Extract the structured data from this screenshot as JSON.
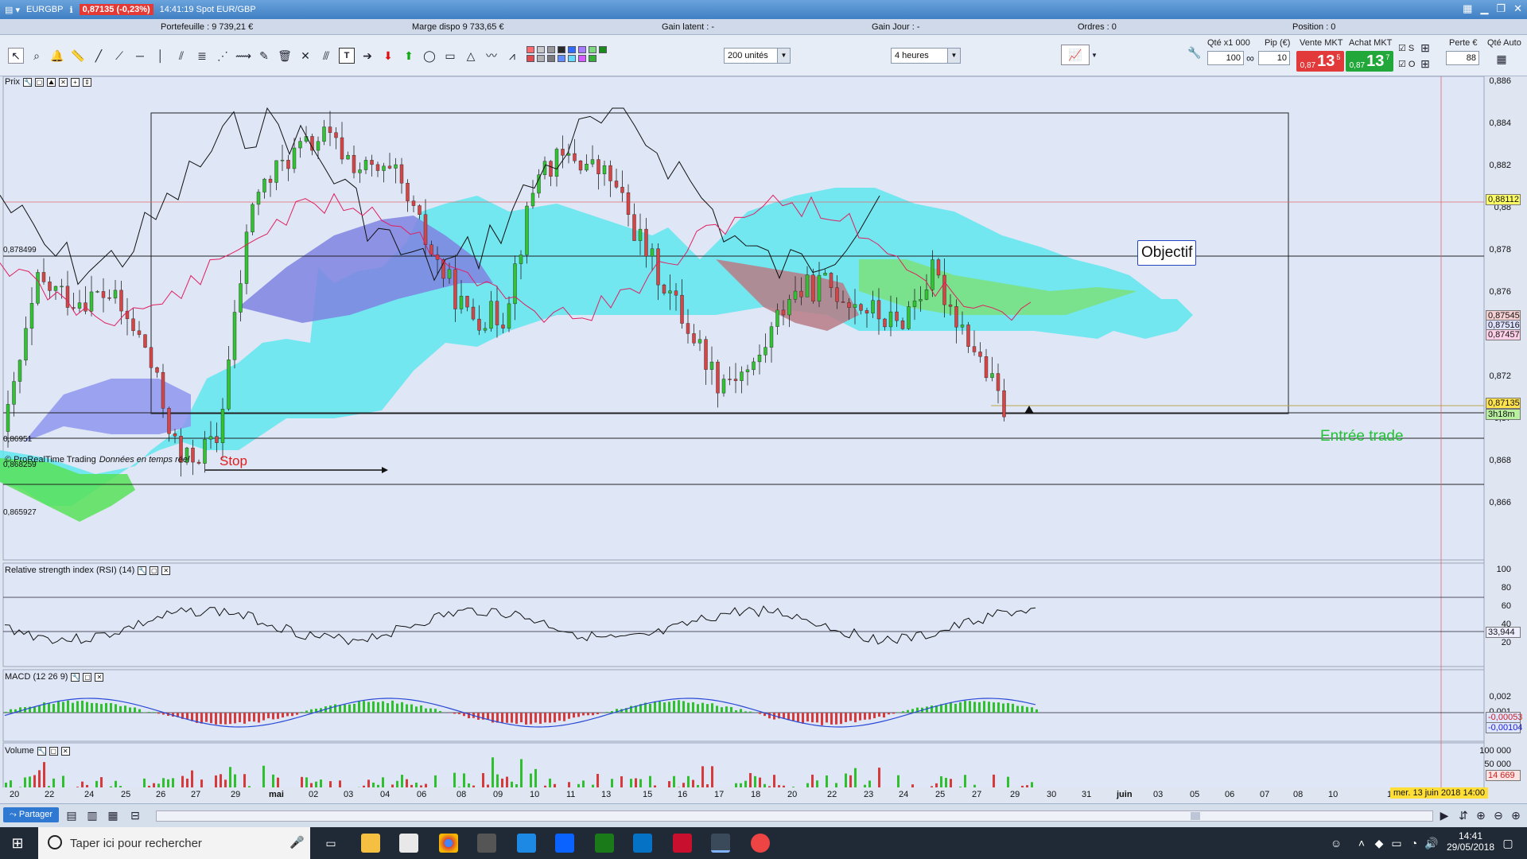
{
  "window": {
    "title": "EURGBP",
    "price_badge": "0,87135 (-0,23%)",
    "time_label": "14:41:19 Spot EUR/GBP"
  },
  "info": {
    "portfolio": "Portefeuille : 9 739,21 €",
    "margin": "Marge dispo  9 733,65 €",
    "gain_latent": "Gain latent : -",
    "gain_jour": "Gain Jour : -",
    "ordres": "Ordres : 0",
    "position": "Position : 0"
  },
  "toolbar": {
    "units_select": "200 unités",
    "timeframe_select": "4 heures",
    "swatch_colors": [
      "#ff6b6b",
      "#e04a4a",
      "#c8c8c8",
      "#b0b0b0",
      "#989898",
      "#7a7a7a",
      "#2a2a2a",
      "#5f8dff",
      "#2e6cff",
      "#62d9ff",
      "#a77cff",
      "#d65cff",
      "#7bd97b",
      "#35b035",
      "#1a8a1a"
    ]
  },
  "order_panel": {
    "qty_label": "Qté x1 000",
    "qty_value": "100",
    "pip_label": "Pip (€)",
    "pip_value": "10",
    "sell_label": "Vente MKT",
    "sell_prefix": "0,87",
    "sell_big": "13",
    "sell_sup": "5",
    "buy_label": "Achat MKT",
    "buy_prefix": "0,87",
    "buy_big": "13",
    "buy_sup": "7",
    "s_label": "S",
    "o_label": "O",
    "perte_label": "Perte €",
    "perte_value": "88",
    "qte_auto_label": "Qté Auto"
  },
  "price_panel": {
    "title": "Prix",
    "copyright": "© ProRealTime Trading",
    "realtime": "Données en temps réel",
    "axis": [
      "0,886",
      "0,884",
      "0,882",
      "0,88",
      "0,878",
      "0,876",
      "0,874",
      "0,872",
      "0,87",
      "0,868",
      "0,866"
    ],
    "tags": [
      {
        "text": "0,88112",
        "color": "#ffff66"
      },
      {
        "text": "0,87545",
        "color": "#f6d0d0"
      },
      {
        "text": "0,87516",
        "color": "#dde0ff"
      },
      {
        "text": "0,87457",
        "color": "#ffd0e8"
      },
      {
        "text": "0,87135",
        "color": "#ffe34d"
      },
      {
        "text": "3h18m",
        "color": "#b9f0a0"
      }
    ],
    "levels": [
      "0,878499",
      "0,86951",
      "0,868259",
      "0,865927"
    ],
    "annotations": {
      "objectif": "Objectif",
      "stop": "Stop",
      "entry": "Entrée trade"
    }
  },
  "rsi_panel": {
    "title": "Relative strength index (RSI) (14)",
    "axis": [
      "100",
      "80",
      "60",
      "40",
      "20"
    ],
    "value_tag": "33,944"
  },
  "macd_panel": {
    "title": "MACD (12 26 9)",
    "axis": [
      "0,002",
      "0,001"
    ],
    "tags": [
      "-0,00053",
      "-0,00104"
    ]
  },
  "volume_panel": {
    "title": "Volume",
    "axis": [
      "100 000",
      "50 000"
    ],
    "value_tag": "14 669"
  },
  "dates": [
    "20",
    "22",
    "24",
    "25",
    "26",
    "27",
    "29",
    "mai",
    "02",
    "03",
    "04",
    "06",
    "08",
    "09",
    "10",
    "11",
    "13",
    "15",
    "16",
    "17",
    "18",
    "20",
    "22",
    "23",
    "24",
    "25",
    "27",
    "29",
    "30",
    "31",
    "juin",
    "03",
    "05",
    "06",
    "07",
    "08",
    "10",
    "12"
  ],
  "crosshair_date": "mer. 13 juin 2018 14:00",
  "bottom": {
    "share_label": "Partager"
  },
  "taskbar": {
    "search_placeholder": "Taper ici pour rechercher",
    "clock_time": "14:41",
    "clock_date": "29/05/2018"
  }
}
